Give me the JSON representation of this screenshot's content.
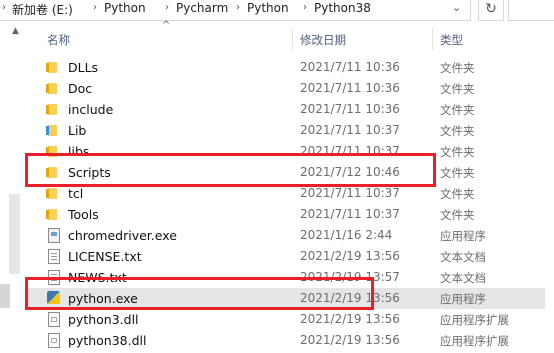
{
  "address": {
    "crumbs": [
      "新加卷 (E:)",
      "Python",
      "Pycharm",
      "Python",
      "Python38"
    ]
  },
  "columns": {
    "name": "名称",
    "date": "修改日期",
    "type": "类型"
  },
  "rows": [
    {
      "name": "DLLs",
      "date": "2021/7/11 10:36",
      "type": "文件夹",
      "icon": "folder-icon"
    },
    {
      "name": "Doc",
      "date": "2021/7/11 10:36",
      "type": "文件夹",
      "icon": "folder-icon"
    },
    {
      "name": "include",
      "date": "2021/7/11 10:36",
      "type": "文件夹",
      "icon": "folder-icon"
    },
    {
      "name": "Lib",
      "date": "2021/7/11 10:37",
      "type": "文件夹",
      "icon": "folder-icon"
    },
    {
      "name": "libs",
      "date": "2021/7/11 10:37",
      "type": "文件夹",
      "icon": "folder-icon"
    },
    {
      "name": "Scripts",
      "date": "2021/7/12 10:46",
      "type": "文件夹",
      "icon": "folder-icon"
    },
    {
      "name": "tcl",
      "date": "2021/7/11 10:37",
      "type": "文件夹",
      "icon": "folder-icon"
    },
    {
      "name": "Tools",
      "date": "2021/7/11 10:37",
      "type": "文件夹",
      "icon": "folder-icon"
    },
    {
      "name": "chromedriver.exe",
      "date": "2021/1/16 2:44",
      "type": "应用程序",
      "icon": "exe-file-icon"
    },
    {
      "name": "LICENSE.txt",
      "date": "2021/2/19 13:56",
      "type": "文本文档",
      "icon": "text-file-icon"
    },
    {
      "name": "NEWS.txt",
      "date": "2021/2/19 13:57",
      "type": "文本文档",
      "icon": "text-file-icon"
    },
    {
      "name": "python.exe",
      "date": "2021/2/19 13:56",
      "type": "应用程序",
      "icon": "python-icon"
    },
    {
      "name": "python3.dll",
      "date": "2021/2/19 13:56",
      "type": "应用程序扩展",
      "icon": "dll-file-icon"
    },
    {
      "name": "python38.dll",
      "date": "2021/2/19 13:56",
      "type": "应用程序扩展",
      "icon": "dll-file-icon"
    }
  ],
  "colors": {
    "highlight": "#e8202a",
    "hover_row": "#e5e5e5",
    "folder": "#f8cf5c"
  }
}
